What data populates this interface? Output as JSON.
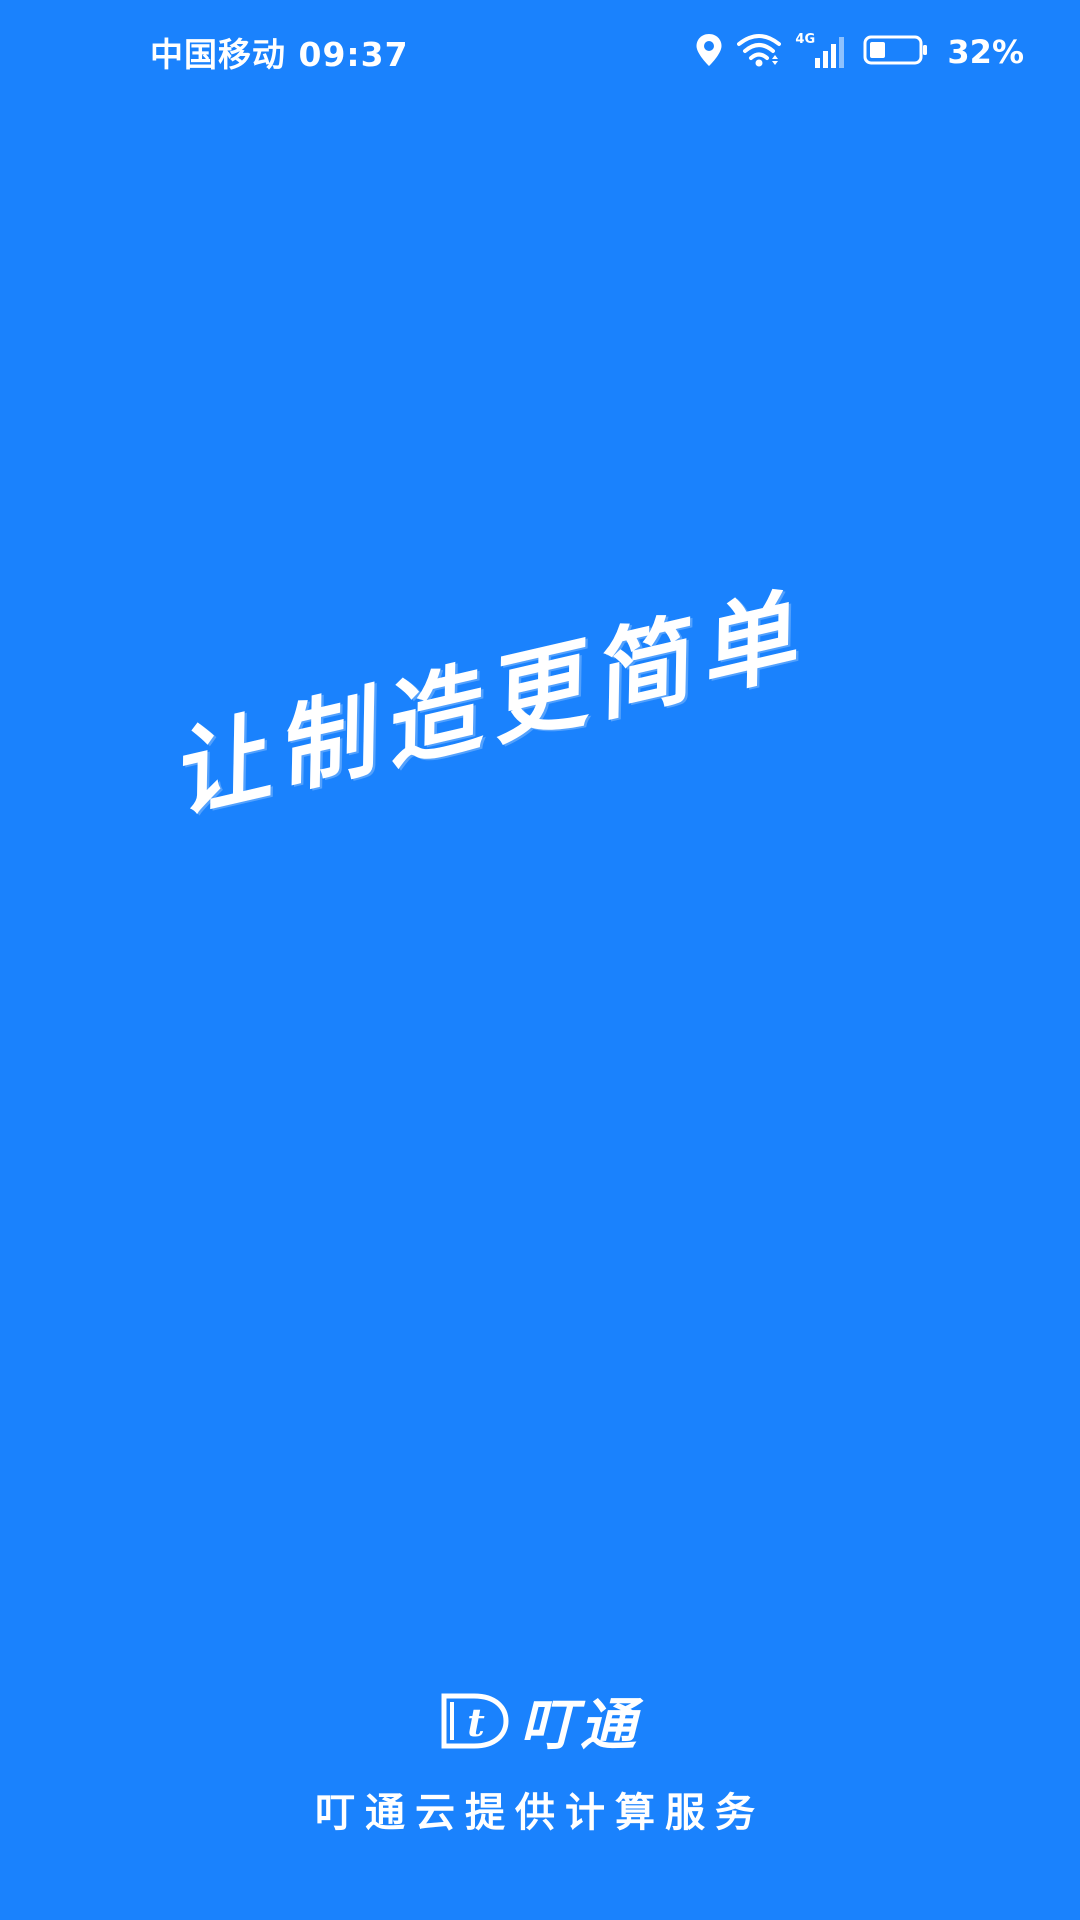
{
  "status_bar": {
    "carrier": "中国移动",
    "time": "09:37",
    "network_type": "4G",
    "battery_percent": "32%",
    "battery_level": 0.32,
    "icons": [
      "location-icon",
      "wifi-icon",
      "cellular-signal-icon",
      "battery-icon"
    ]
  },
  "splash": {
    "slogan": "让制造更简单",
    "brand_name": "叮通",
    "tagline": "叮通云提供计算服务"
  },
  "colors": {
    "background": "#1a82fd",
    "foreground": "#ffffff"
  }
}
